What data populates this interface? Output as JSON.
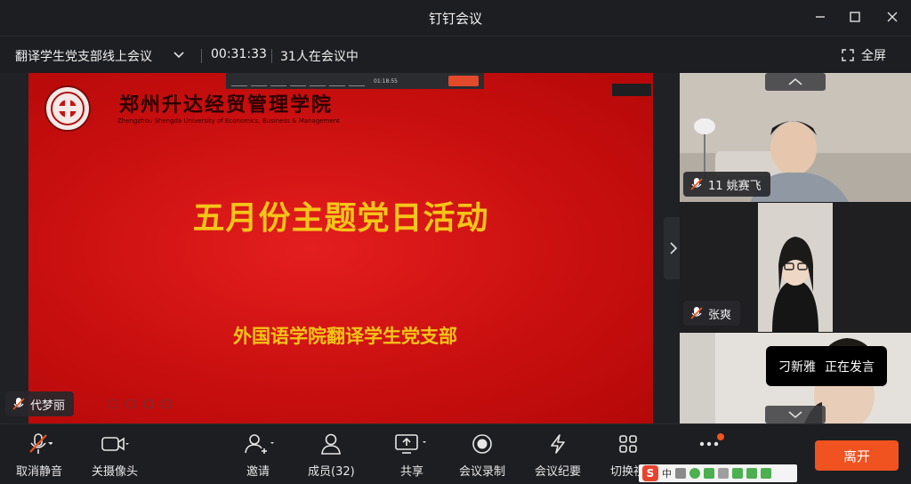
{
  "window": {
    "title": "钉钉会议"
  },
  "infobar": {
    "meeting_name": "翻译学生党支部线上会议",
    "elapsed": "00:31:33",
    "participants_in_meeting": "31人在会议中",
    "fullscreen_label": "全屏"
  },
  "slide": {
    "school_name": "郑州升达经贸管理学院",
    "school_name_en": "Zhengzhou Shengda University of Economics, Business & Management",
    "main_title": "五月份主题党日活动",
    "subtitle": "外国语学院翻译学生党支部",
    "inner_timer": "01:18:55"
  },
  "presenter": {
    "name": "代梦丽"
  },
  "participants": [
    {
      "name": "11 姚赛飞"
    },
    {
      "name": "张爽"
    },
    {
      "name": "刁新雅"
    }
  ],
  "speaking_banner": {
    "name": "刁新雅",
    "status": "正在发言"
  },
  "toolbar": {
    "mute_label": "取消静音",
    "camera_label": "关摄像头",
    "invite_label": "邀请",
    "members_label": "成员(32)",
    "share_label": "共享",
    "record_label": "会议录制",
    "minutes_label": "会议纪要",
    "layout_label": "切换视",
    "more_label": "更多",
    "leave_label": "离开"
  },
  "ime": {
    "char": "中"
  },
  "colors": {
    "accent": "#f0531f",
    "slide_red": "#d41414",
    "slide_title_yellow": "#f5c518",
    "bar_bg": "#1d1e21"
  }
}
